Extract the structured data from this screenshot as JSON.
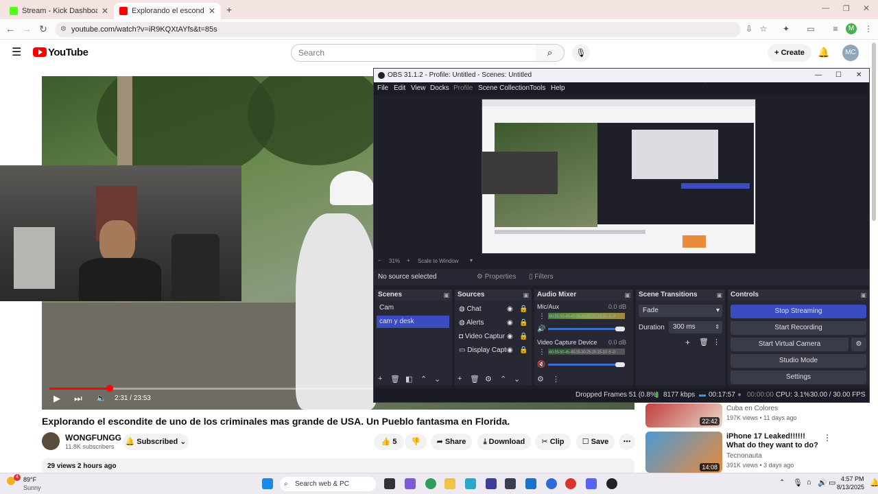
{
  "browser": {
    "tabs": [
      {
        "title": "Stream - Kick Dashboard",
        "icon": "kick-icon"
      },
      {
        "title": "Explorando el escondite de uno de los",
        "icon": "youtube-icon"
      }
    ],
    "url": "youtube.com/watch?v=iR9KQXtAYfs&t=85s",
    "profile_initial": "M"
  },
  "youtube": {
    "logo_text": "YouTube",
    "search_placeholder": "Search",
    "create_label": "Create",
    "avatar_initials": "MC",
    "video": {
      "title": "Explorando el escondite de uno de los criminales mas grande de USA. Un Pueblo fantasma en Florida.",
      "time": "2:31 / 23:53",
      "progress": 0.105,
      "channel": "WONGFUNGG",
      "subscribers": "11.8K subscribers",
      "subscribed_label": "Subscribed",
      "likes": "5",
      "share_label": "Share",
      "download_label": "Download",
      "clip_label": "Clip",
      "save_label": "Save",
      "views_line": "29 views  2 hours ago"
    },
    "recommendations": [
      {
        "title": "",
        "channel": "Cuba en Colores",
        "meta": "197K views • 11 days ago",
        "duration": "22:42"
      },
      {
        "title": "iPhone 17 Leaked!!!!!! What do they want to do?",
        "channel": "Tecnonauta",
        "meta": "391K views • 3 days ago",
        "duration": "14:08"
      }
    ]
  },
  "obs": {
    "title": "OBS 31.1.2 - Profile: Untitled - Scenes: Untitled",
    "menu": [
      "File",
      "Edit",
      "View",
      "Docks",
      "Profile",
      "Scene Collection",
      "Tools",
      "Help"
    ],
    "zoom": "31%",
    "scale_label": "Scale to Window",
    "no_source": "No source selected",
    "properties_label": "Properties",
    "filters_label": "Filters",
    "scenes_header": "Scenes",
    "scenes": [
      "Cam",
      "cam y desk"
    ],
    "selected_scene": 1,
    "sources_header": "Sources",
    "sources": [
      "Chat",
      "Alerts",
      "Video Captur",
      "Display Captu"
    ],
    "mixer_header": "Audio Mixer",
    "mixer_channels": [
      {
        "name": "Mic/Aux",
        "db": "0.0 dB",
        "ticks": "-60-55-50-45-40-35-30-25-20-15-10 -5 -0"
      },
      {
        "name": "Video Capture Device",
        "db": "0.0 dB",
        "ticks": "-60-55-50-45-40-35-30-25-20-15-10 -5 -0"
      }
    ],
    "transitions_header": "Scene Transitions",
    "transition": "Fade",
    "duration_label": "Duration",
    "duration_value": "300 ms",
    "controls_header": "Controls",
    "controls": [
      "Stop Streaming",
      "Start Recording",
      "Start Virtual Camera",
      "Studio Mode",
      "Settings"
    ],
    "status": {
      "dropped": "Dropped Frames 51 (0.8%)",
      "bitrate": "8177 kbps",
      "stream_time": "00:17:57",
      "rec_time": "00:00:00",
      "cpu": "CPU: 3.1%",
      "fps": "30.00 / 30.00 FPS"
    }
  },
  "taskbar": {
    "weather_temp": "89°F",
    "weather_desc": "Sunny",
    "search_label": "Search web & PC",
    "time": "4:57 PM",
    "date": "8/13/2025",
    "weather_badge": "4"
  },
  "colors": {
    "youtube_red": "#ff0000",
    "obs_accent": "#3b4cc0",
    "obs_bg": "#1e1f29"
  }
}
